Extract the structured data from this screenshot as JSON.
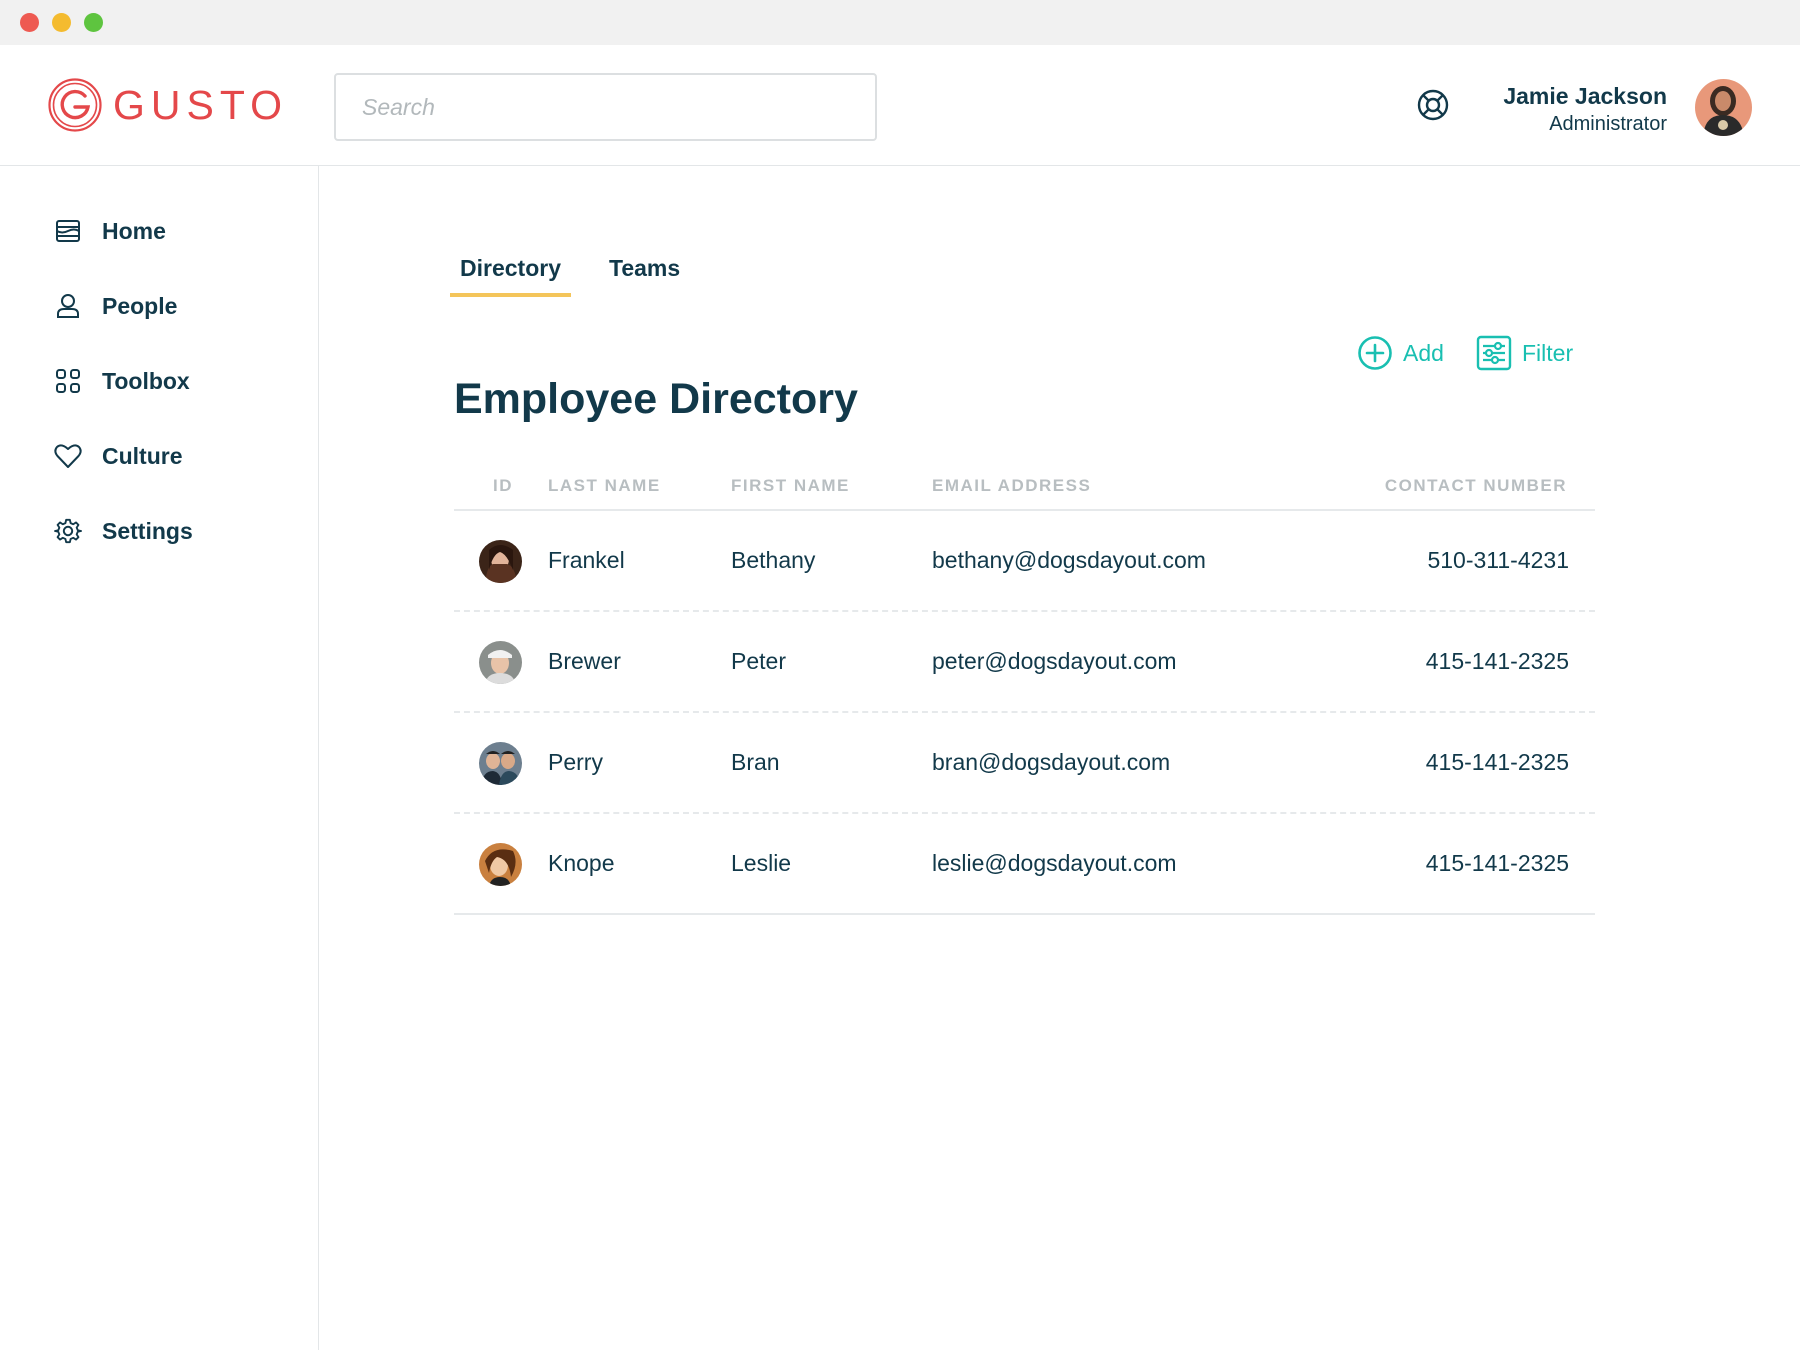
{
  "brand": {
    "name": "GUSTO",
    "color": "#e4484a"
  },
  "colors": {
    "accent": "#19bfb1",
    "tab_underline": "#f4c55a",
    "text": "#12394a"
  },
  "search": {
    "placeholder": "Search"
  },
  "user": {
    "name": "Jamie Jackson",
    "role": "Administrator"
  },
  "sidebar": {
    "items": [
      {
        "label": "Home",
        "icon": "home-icon"
      },
      {
        "label": "People",
        "icon": "person-icon"
      },
      {
        "label": "Toolbox",
        "icon": "grid-icon"
      },
      {
        "label": "Culture",
        "icon": "heart-icon"
      },
      {
        "label": "Settings",
        "icon": "gear-icon"
      }
    ]
  },
  "tabs": [
    {
      "label": "Directory",
      "active": true
    },
    {
      "label": "Teams",
      "active": false
    }
  ],
  "actions": {
    "add": "Add",
    "filter": "Filter"
  },
  "page": {
    "title": "Employee Directory"
  },
  "table": {
    "columns": [
      "ID",
      "LAST NAME",
      "FIRST NAME",
      "EMAIL ADDRESS",
      "CONTACT NUMBER"
    ],
    "rows": [
      {
        "last": "Frankel",
        "first": "Bethany",
        "email": "bethany@dogsdayout.com",
        "phone": "510-311-4231"
      },
      {
        "last": "Brewer",
        "first": "Peter",
        "email": "peter@dogsdayout.com",
        "phone": "415-141-2325"
      },
      {
        "last": "Perry",
        "first": "Bran",
        "email": "bran@dogsdayout.com",
        "phone": "415-141-2325"
      },
      {
        "last": "Knope",
        "first": "Leslie",
        "email": "leslie@dogsdayout.com",
        "phone": "415-141-2325"
      }
    ]
  }
}
